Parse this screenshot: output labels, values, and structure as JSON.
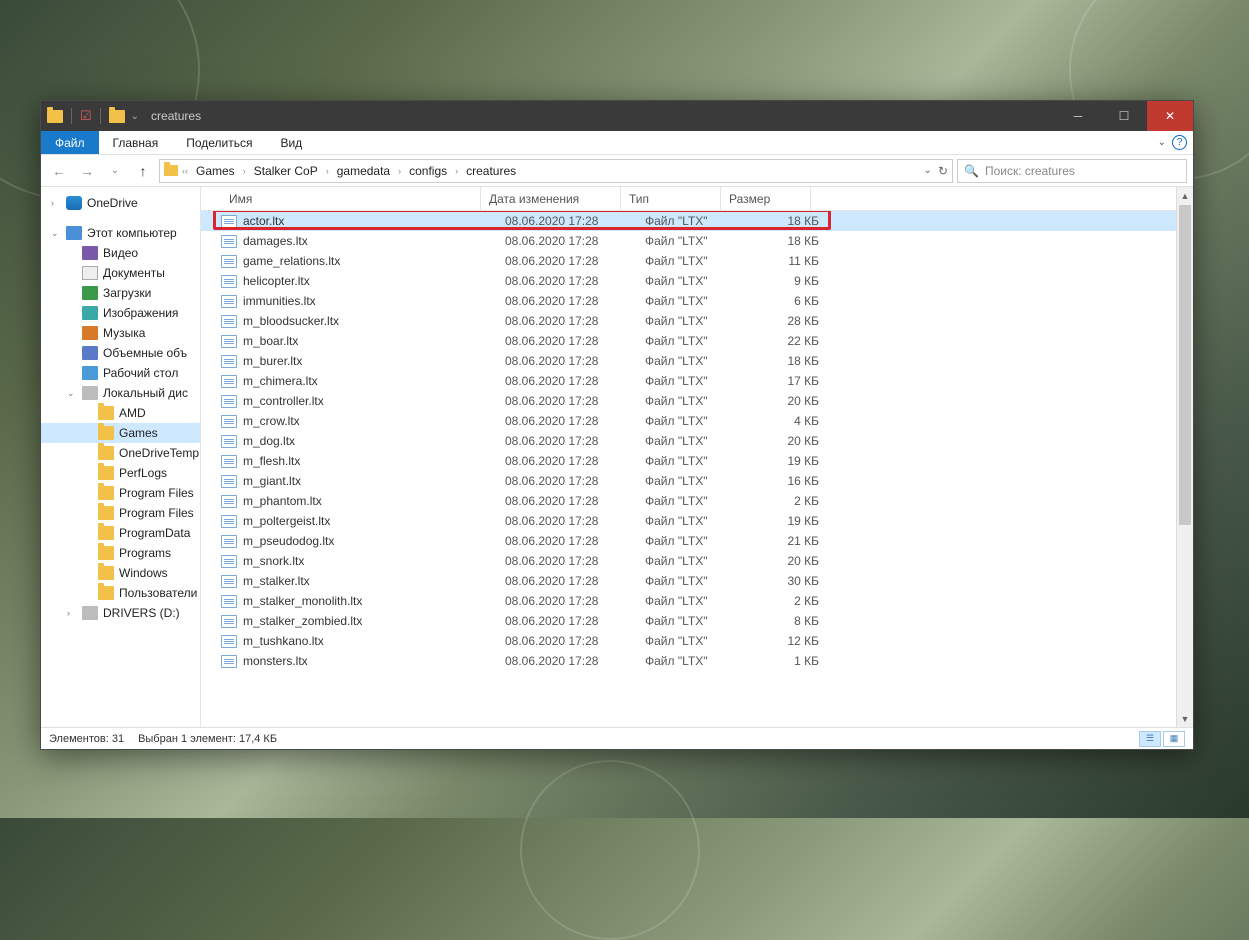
{
  "window": {
    "title": "creatures"
  },
  "ribbon": {
    "tabs": [
      "Файл",
      "Главная",
      "Поделиться",
      "Вид"
    ]
  },
  "breadcrumb": [
    "Games",
    "Stalker CoP",
    "gamedata",
    "configs",
    "creatures"
  ],
  "search": {
    "placeholder": "Поиск: creatures"
  },
  "nav": {
    "onedrive": "OneDrive",
    "thispc": "Этот компьютер",
    "video": "Видео",
    "documents": "Документы",
    "downloads": "Загрузки",
    "images": "Изображения",
    "music": "Музыка",
    "objects3d": "Объемные объ",
    "desktop": "Рабочий стол",
    "localdisk": "Локальный дис",
    "amd": "AMD",
    "games": "Games",
    "onedrivetemp": "OneDriveTemp",
    "perflogs": "PerfLogs",
    "programfiles": "Program Files",
    "programfiles86": "Program Files",
    "programdata": "ProgramData",
    "programs": "Programs",
    "windows": "Windows",
    "users": "Пользователи",
    "drivers": "DRIVERS (D:)"
  },
  "columns": {
    "name": "Имя",
    "date": "Дата изменения",
    "type": "Тип",
    "size": "Размер"
  },
  "files": [
    {
      "name": "actor.ltx",
      "date": "08.06.2020 17:28",
      "type": "Файл \"LTX\"",
      "size": "18 КБ",
      "selected": true,
      "highlight": true
    },
    {
      "name": "damages.ltx",
      "date": "08.06.2020 17:28",
      "type": "Файл \"LTX\"",
      "size": "18 КБ"
    },
    {
      "name": "game_relations.ltx",
      "date": "08.06.2020 17:28",
      "type": "Файл \"LTX\"",
      "size": "11 КБ"
    },
    {
      "name": "helicopter.ltx",
      "date": "08.06.2020 17:28",
      "type": "Файл \"LTX\"",
      "size": "9 КБ"
    },
    {
      "name": "immunities.ltx",
      "date": "08.06.2020 17:28",
      "type": "Файл \"LTX\"",
      "size": "6 КБ"
    },
    {
      "name": "m_bloodsucker.ltx",
      "date": "08.06.2020 17:28",
      "type": "Файл \"LTX\"",
      "size": "28 КБ"
    },
    {
      "name": "m_boar.ltx",
      "date": "08.06.2020 17:28",
      "type": "Файл \"LTX\"",
      "size": "22 КБ"
    },
    {
      "name": "m_burer.ltx",
      "date": "08.06.2020 17:28",
      "type": "Файл \"LTX\"",
      "size": "18 КБ"
    },
    {
      "name": "m_chimera.ltx",
      "date": "08.06.2020 17:28",
      "type": "Файл \"LTX\"",
      "size": "17 КБ"
    },
    {
      "name": "m_controller.ltx",
      "date": "08.06.2020 17:28",
      "type": "Файл \"LTX\"",
      "size": "20 КБ"
    },
    {
      "name": "m_crow.ltx",
      "date": "08.06.2020 17:28",
      "type": "Файл \"LTX\"",
      "size": "4 КБ"
    },
    {
      "name": "m_dog.ltx",
      "date": "08.06.2020 17:28",
      "type": "Файл \"LTX\"",
      "size": "20 КБ"
    },
    {
      "name": "m_flesh.ltx",
      "date": "08.06.2020 17:28",
      "type": "Файл \"LTX\"",
      "size": "19 КБ"
    },
    {
      "name": "m_giant.ltx",
      "date": "08.06.2020 17:28",
      "type": "Файл \"LTX\"",
      "size": "16 КБ"
    },
    {
      "name": "m_phantom.ltx",
      "date": "08.06.2020 17:28",
      "type": "Файл \"LTX\"",
      "size": "2 КБ"
    },
    {
      "name": "m_poltergeist.ltx",
      "date": "08.06.2020 17:28",
      "type": "Файл \"LTX\"",
      "size": "19 КБ"
    },
    {
      "name": "m_pseudodog.ltx",
      "date": "08.06.2020 17:28",
      "type": "Файл \"LTX\"",
      "size": "21 КБ"
    },
    {
      "name": "m_snork.ltx",
      "date": "08.06.2020 17:28",
      "type": "Файл \"LTX\"",
      "size": "20 КБ"
    },
    {
      "name": "m_stalker.ltx",
      "date": "08.06.2020 17:28",
      "type": "Файл \"LTX\"",
      "size": "30 КБ"
    },
    {
      "name": "m_stalker_monolith.ltx",
      "date": "08.06.2020 17:28",
      "type": "Файл \"LTX\"",
      "size": "2 КБ"
    },
    {
      "name": "m_stalker_zombied.ltx",
      "date": "08.06.2020 17:28",
      "type": "Файл \"LTX\"",
      "size": "8 КБ"
    },
    {
      "name": "m_tushkano.ltx",
      "date": "08.06.2020 17:28",
      "type": "Файл \"LTX\"",
      "size": "12 КБ"
    },
    {
      "name": "monsters.ltx",
      "date": "08.06.2020 17:28",
      "type": "Файл \"LTX\"",
      "size": "1 КБ"
    }
  ],
  "status": {
    "elements": "Элементов: 31",
    "selected": "Выбран 1 элемент: 17,4 КБ"
  }
}
